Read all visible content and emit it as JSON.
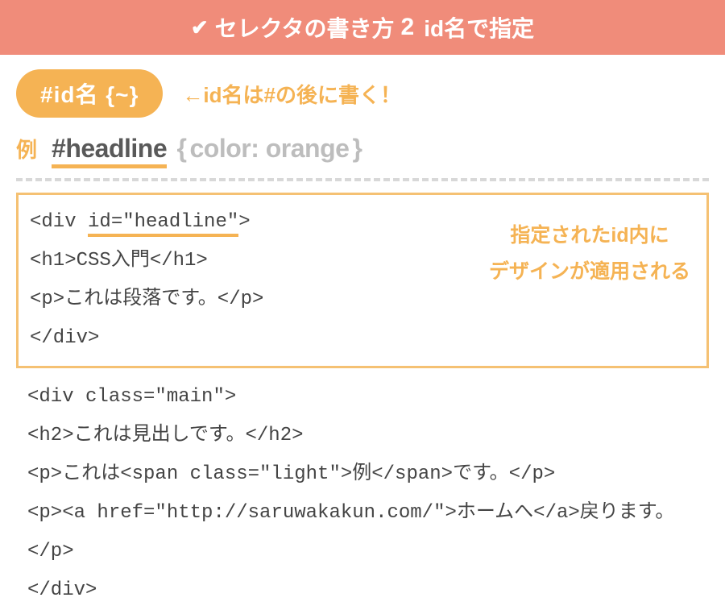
{
  "header": {
    "check": "✔",
    "part1": "セレクタの書き方",
    "num": "2",
    "part2": "id名で指定"
  },
  "pill": "#id名 {~}",
  "hint": "←id名は#の後に書く！",
  "example": {
    "label": "例",
    "selector": "#headline",
    "braceOpen": "{",
    "prop": "color: orange",
    "braceClose": "}"
  },
  "codeBox": {
    "line1a": "<div ",
    "line1b": "id=\"headline\"",
    "line1c": ">",
    "line2": "<h1>CSS入門</h1>",
    "line3": "<p>これは段落です。</p>",
    "line4": "</div>"
  },
  "note": {
    "line1": "指定されたid内に",
    "line2": "デザインが適用される"
  },
  "codeAfter": {
    "line1": "<div class=\"main\">",
    "line2": "<h2>これは見出しです。</h2>",
    "line3": "<p>これは<span class=\"light\">例</span>です。</p>",
    "line4": "<p><a href=\"http://saruwakakun.com/\">ホームへ</a>戻ります。</p>",
    "line5": "</div>"
  }
}
